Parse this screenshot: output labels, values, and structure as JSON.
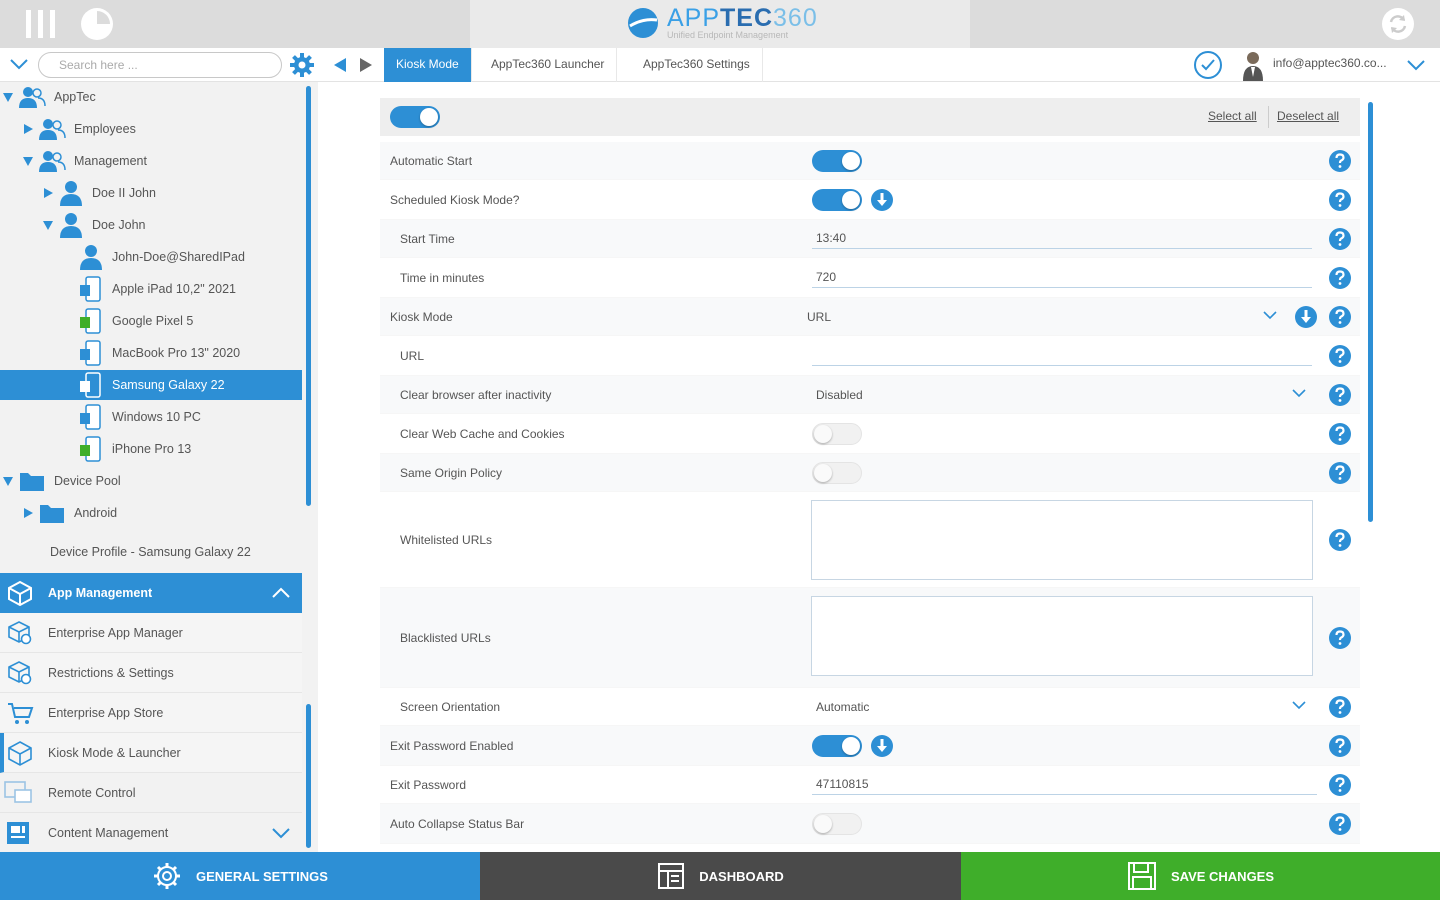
{
  "app": {
    "logo_app": "APP",
    "logo_tec": "TEC",
    "logo_num": "360",
    "logo_subtitle": "Unified Endpoint Management"
  },
  "toolbar": {
    "search_placeholder": "Search here ...",
    "tabs": [
      "Kiosk Mode",
      "AppTec360 Launcher",
      "AppTec360 Settings"
    ],
    "active_tab": "Kiosk Mode",
    "user_email": "info@apptec360.co..."
  },
  "tree": [
    {
      "label": "AppTec",
      "icon": "group-icon",
      "expanded": true
    },
    {
      "label": "Employees",
      "icon": "group-icon",
      "expanded": false
    },
    {
      "label": "Management",
      "icon": "group-icon",
      "expanded": true
    },
    {
      "label": "Doe II John",
      "icon": "user-icon",
      "expanded": false
    },
    {
      "label": "Doe John",
      "icon": "user-icon",
      "expanded": true
    },
    {
      "label": "John-Doe@SharedIPad",
      "icon": "user-icon"
    },
    {
      "label": "Apple iPad 10,2\" 2021",
      "icon": "apple-device-icon"
    },
    {
      "label": "Google Pixel 5",
      "icon": "android-device-icon"
    },
    {
      "label": "MacBook Pro 13\" 2020",
      "icon": "apple-device-icon"
    },
    {
      "label": "Samsung Galaxy 22",
      "icon": "android-device-icon",
      "selected": true
    },
    {
      "label": "Windows 10 PC",
      "icon": "windows-device-icon"
    },
    {
      "label": "iPhone Pro 13",
      "icon": "iphone-device-icon"
    },
    {
      "label": "Device Pool",
      "icon": "folder-icon",
      "expanded": true
    },
    {
      "label": "Android",
      "icon": "folder-icon",
      "expanded": false
    }
  ],
  "sidebar": {
    "device_profile": "Device Profile - Samsung Galaxy 22",
    "app_management_label": "App Management",
    "menu_items": [
      {
        "label": "Enterprise App Manager",
        "icon": "cube-gear-icon"
      },
      {
        "label": "Restrictions & Settings",
        "icon": "cube-gear-icon"
      },
      {
        "label": "Enterprise App Store",
        "icon": "cart-icon"
      },
      {
        "label": "Kiosk Mode & Launcher",
        "icon": "cube-icon",
        "active": true
      },
      {
        "label": "Remote Control",
        "icon": "remote-screen-icon"
      },
      {
        "label": "Content Management",
        "icon": "content-icon"
      }
    ]
  },
  "panel": {
    "master_toggle": true,
    "select_all": "Select all",
    "deselect_all": "Deselect all",
    "settings": [
      {
        "label": "Automatic Start",
        "type": "toggle",
        "value": true
      },
      {
        "label": "Scheduled Kiosk Mode?",
        "type": "toggle",
        "value": true,
        "download": true
      },
      {
        "label": "Start Time",
        "type": "text",
        "value": "13:40"
      },
      {
        "label": "Time in minutes",
        "type": "text",
        "value": "720"
      },
      {
        "label": "Kiosk Mode",
        "type": "select",
        "value": "URL",
        "download": true
      },
      {
        "label": "URL",
        "type": "text",
        "value": ""
      },
      {
        "label": "Clear browser after inactivity",
        "type": "select",
        "value": "Disabled"
      },
      {
        "label": "Clear Web Cache and Cookies",
        "type": "toggle",
        "value": false
      },
      {
        "label": "Same Origin Policy",
        "type": "toggle",
        "value": false
      },
      {
        "label": "Whitelisted URLs",
        "type": "textarea",
        "value": ""
      },
      {
        "label": "Blacklisted URLs",
        "type": "textarea",
        "value": ""
      },
      {
        "label": "Screen Orientation",
        "type": "select",
        "value": "Automatic"
      },
      {
        "label": "Exit Password Enabled",
        "type": "toggle",
        "value": true,
        "download": true
      },
      {
        "label": "Exit Password",
        "type": "text",
        "value": "47110815"
      },
      {
        "label": "Auto Collapse Status Bar",
        "type": "toggle",
        "value": false
      }
    ]
  },
  "bottom": {
    "general_settings": "GENERAL SETTINGS",
    "dashboard": "DASHBOARD",
    "save_changes": "SAVE CHANGES"
  },
  "colors": {
    "accent": "#2d8fd5",
    "dashboard_bg": "#4a4a4a",
    "save_bg": "#3fae2a",
    "topbar_bg": "#dcdcdc"
  }
}
